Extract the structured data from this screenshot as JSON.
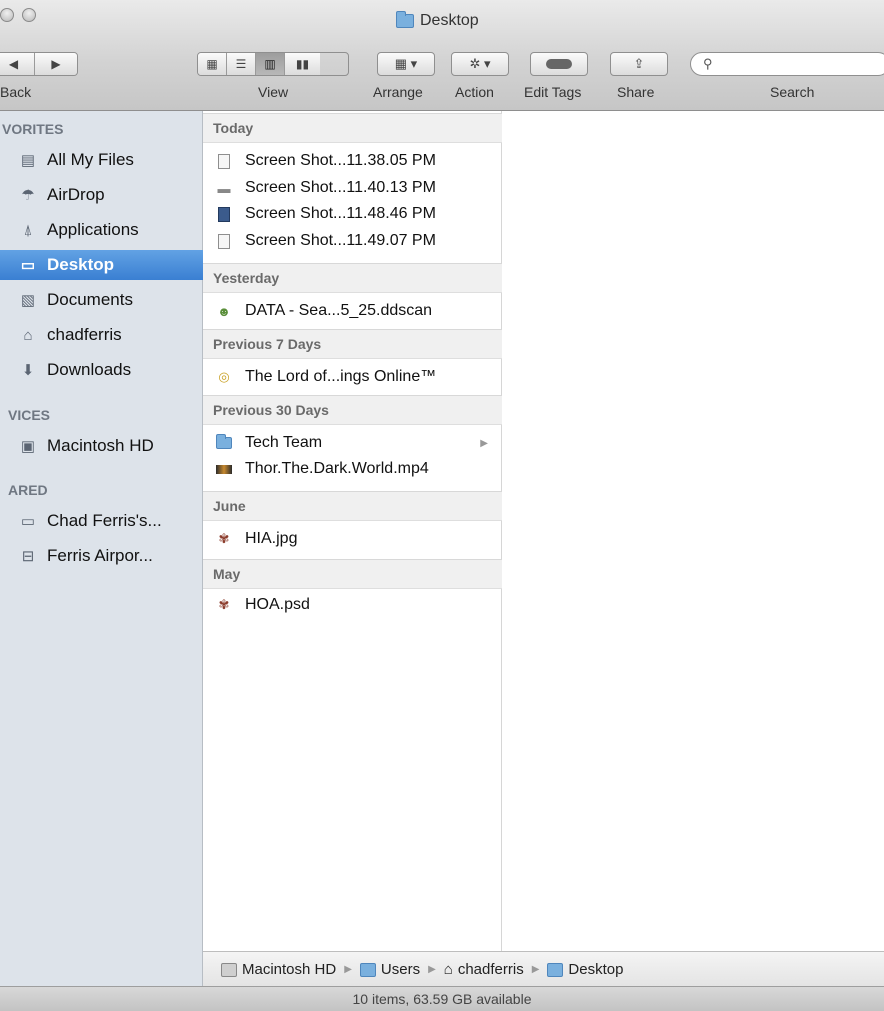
{
  "window": {
    "title": "Desktop"
  },
  "toolbar": {
    "back_label": "Back",
    "view_label": "View",
    "arrange_label": "Arrange",
    "action_label": "Action",
    "edit_tags_label": "Edit Tags",
    "share_label": "Share",
    "search_label": "Search",
    "search_placeholder": ""
  },
  "sidebar": {
    "favorites_header": "VORITES",
    "favorites": [
      {
        "label": "All My Files",
        "icon": "all-files-icon"
      },
      {
        "label": "AirDrop",
        "icon": "airdrop-icon"
      },
      {
        "label": "Applications",
        "icon": "applications-icon"
      },
      {
        "label": "Desktop",
        "icon": "desktop-icon",
        "selected": true
      },
      {
        "label": "Documents",
        "icon": "documents-icon"
      },
      {
        "label": "chadferris",
        "icon": "home-icon"
      },
      {
        "label": "Downloads",
        "icon": "downloads-icon"
      }
    ],
    "devices_header": "VICES",
    "devices": [
      {
        "label": "Macintosh HD",
        "icon": "hard-drive-icon"
      }
    ],
    "shared_header": "ARED",
    "shared": [
      {
        "label": "Chad Ferris's...",
        "icon": "computer-icon"
      },
      {
        "label": "Ferris Airpor...",
        "icon": "airport-icon"
      }
    ]
  },
  "groups": [
    {
      "header": "Today",
      "items": [
        {
          "name": "Screen Shot...11.38.05 PM"
        },
        {
          "name": "Screen Shot...11.40.13 PM"
        },
        {
          "name": "Screen Shot...11.48.46 PM"
        },
        {
          "name": "Screen Shot...11.49.07 PM"
        }
      ]
    },
    {
      "header": "Yesterday",
      "items": [
        {
          "name": "DATA - Sea...5_25.ddscan"
        }
      ]
    },
    {
      "header": "Previous 7 Days",
      "items": [
        {
          "name": "The Lord of...ings Online™"
        }
      ]
    },
    {
      "header": "Previous 30 Days",
      "items": [
        {
          "name": "Tech Team"
        },
        {
          "name": "Thor.The.Dark.World.mp4"
        }
      ]
    },
    {
      "header": "June",
      "items": [
        {
          "name": "HIA.jpg"
        }
      ]
    },
    {
      "header": "May",
      "items": [
        {
          "name": "HOA.psd"
        }
      ]
    }
  ],
  "pathbar": {
    "segments": [
      "Macintosh HD",
      "Users",
      "chadferris",
      "Desktop"
    ]
  },
  "status": {
    "text": "10 items, 63.59 GB available"
  },
  "colors": {
    "selection": "#3a7fd2",
    "sidebar_bg": "#dde3ea",
    "folder": "#7ab0de"
  }
}
